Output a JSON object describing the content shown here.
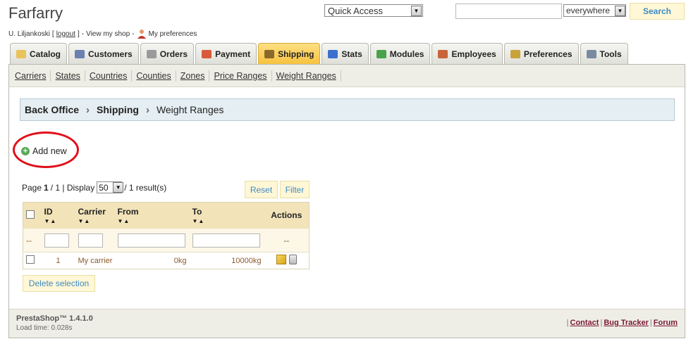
{
  "header": {
    "shop_name": "Farfarry",
    "user": "U. Liljankoski",
    "bracket_open": "[",
    "logout": "logout",
    "bracket_close": "]",
    "dash1": "-",
    "view_shop": "View my shop",
    "dash2": "-",
    "preferences": "My preferences",
    "quick_access": "Quick Access",
    "search_value": "",
    "search_scope": "everywhere",
    "search_button": "Search"
  },
  "tabs": [
    {
      "label": "Catalog",
      "icon": "folder-icon",
      "color": "#e8c25a"
    },
    {
      "label": "Customers",
      "icon": "customers-icon",
      "color": "#6b7fb0"
    },
    {
      "label": "Orders",
      "icon": "cart-icon",
      "color": "#9a9a9a"
    },
    {
      "label": "Payment",
      "icon": "payment-icon",
      "color": "#d85a3a"
    },
    {
      "label": "Shipping",
      "icon": "truck-icon",
      "color": "#8a6a2a"
    },
    {
      "label": "Stats",
      "icon": "stats-icon",
      "color": "#3a6fcf"
    },
    {
      "label": "Modules",
      "icon": "puzzle-icon",
      "color": "#4aa34a"
    },
    {
      "label": "Employees",
      "icon": "employee-icon",
      "color": "#c9633a"
    },
    {
      "label": "Preferences",
      "icon": "preferences-icon",
      "color": "#c9a23a"
    },
    {
      "label": "Tools",
      "icon": "wrench-icon",
      "color": "#7a8aa0"
    }
  ],
  "active_tab": "Shipping",
  "subnav": [
    "Carriers",
    "States",
    "Countries",
    "Counties",
    "Zones",
    "Price Ranges",
    "Weight Ranges"
  ],
  "breadcrumb": {
    "root": "Back Office",
    "section": "Shipping",
    "current": "Weight Ranges"
  },
  "add_new": "Add new",
  "pager": {
    "page_label": "Page",
    "page": "1",
    "of": "/ 1 | Display",
    "display": "50",
    "results": "/ 1 result(s)"
  },
  "buttons": {
    "reset": "Reset",
    "filter": "Filter",
    "delete_selection": "Delete selection"
  },
  "table": {
    "headers": {
      "id": "ID",
      "carrier": "Carrier",
      "from": "From",
      "to": "To",
      "actions": "Actions"
    },
    "sort_arrows": "▼▲",
    "filter_placeholder": "--",
    "filter_actions": "--",
    "rows": [
      {
        "id": "1",
        "carrier": "My carrier",
        "from": "0kg",
        "to": "10000kg"
      }
    ]
  },
  "footer": {
    "version": "PrestaShop™ 1.4.1.0",
    "load_time": "Load time: 0.028s",
    "pipe": "|",
    "links": [
      "Contact",
      "Bug Tracker",
      "Forum"
    ]
  },
  "colors": {
    "accent": "#3d8bc5",
    "active_tab": "#f6c340",
    "annotation_circle": "#e0101a"
  }
}
